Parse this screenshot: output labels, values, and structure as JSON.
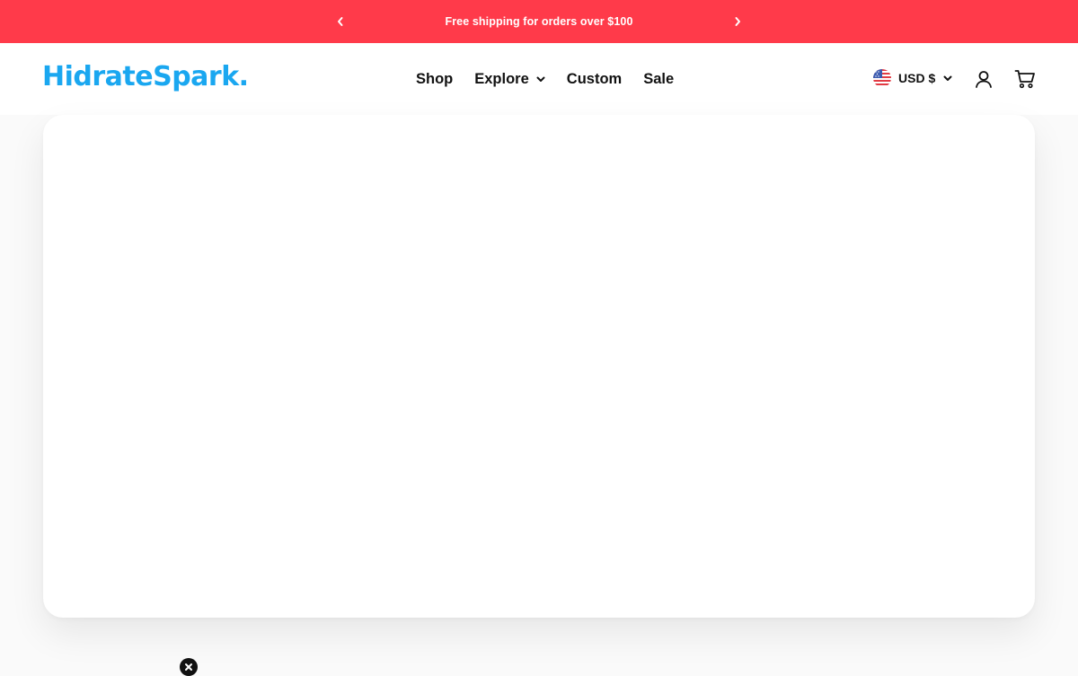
{
  "announcement": {
    "text": "Free shipping for orders over $100",
    "prev_icon": "chevron-left-icon",
    "next_icon": "chevron-right-icon",
    "background": "#ff3a4a"
  },
  "header": {
    "logo_text": "HidrateSpark",
    "logo_dot": ".",
    "brand_color": "#1aa7f0",
    "nav": [
      {
        "label": "Shop"
      },
      {
        "label": "Explore",
        "has_dropdown": true
      },
      {
        "label": "Custom"
      },
      {
        "label": "Sale"
      }
    ],
    "currency": {
      "label": "USD $",
      "flag_icon": "us-flag-icon"
    },
    "account_icon": "user-icon",
    "cart_icon": "cart-icon"
  },
  "hero": {
    "content": ""
  },
  "overlay": {
    "close_icon": "close-icon"
  }
}
